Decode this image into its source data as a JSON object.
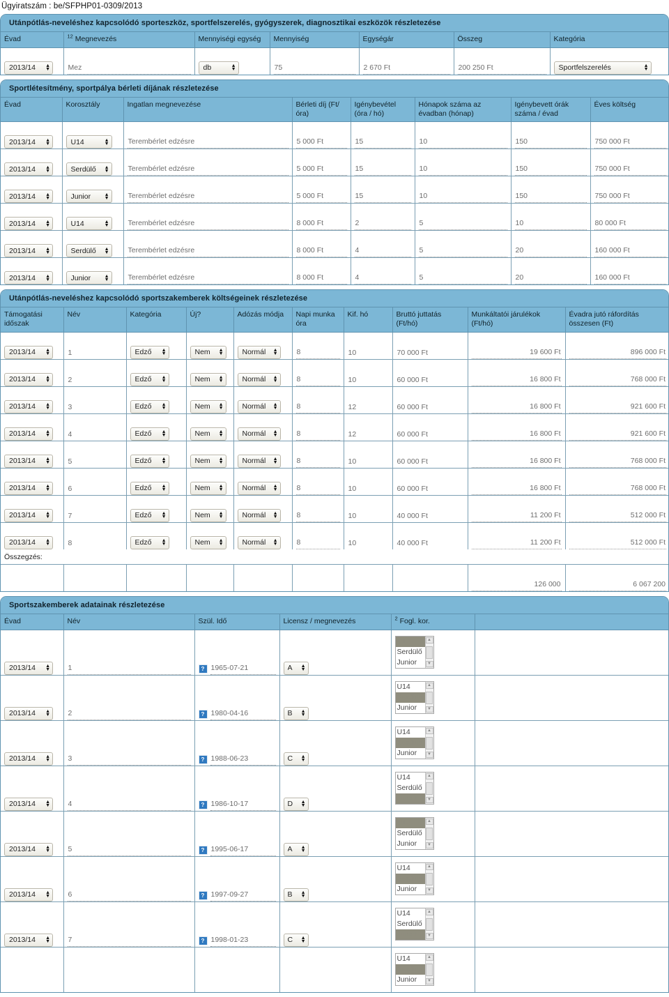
{
  "document": {
    "case_number_label": "Ügyiratszám : be/SFPHP01-0309/2013"
  },
  "section_equipment": {
    "title": "Utánpótlás-neveléshez kapcsolódó sporteszköz, sportfelszerelés, gyógyszerek, diagnosztikai eszközök részletezése",
    "columns": [
      {
        "sup": "",
        "label": "Évad"
      },
      {
        "sup": "12",
        "label": "Megnevezés"
      },
      {
        "sup": "",
        "label": "Mennyiségi egység"
      },
      {
        "sup": "",
        "label": "Mennyiség"
      },
      {
        "sup": "",
        "label": "Egységár"
      },
      {
        "sup": "",
        "label": "Összeg"
      },
      {
        "sup": "",
        "label": "Kategória"
      }
    ],
    "rows": [
      {
        "evad": "2013/14",
        "megnevezes": "Mez",
        "egyseg": "db",
        "mennyiseg": "75",
        "egysegar": "2 670 Ft",
        "osszeg": "200 250 Ft",
        "kategoria": "Sportfelszerelés"
      }
    ]
  },
  "section_rental": {
    "title": "Sportlétesítmény, sportpálya bérleti díjának részletezése",
    "columns": [
      {
        "label": "Évad"
      },
      {
        "label": "Korosztály"
      },
      {
        "label": "Ingatlan megnevezése"
      },
      {
        "label": "Bérleti díj (Ft/óra)"
      },
      {
        "label": "Igénybevétel (óra / hó)"
      },
      {
        "label": "Hónapok száma az évadban (hónap)"
      },
      {
        "label": "Igénybevett órák száma / évad"
      },
      {
        "label": "Éves&nbspköltség"
      }
    ],
    "rows": [
      {
        "evad": "2013/14",
        "korosztaly": "U14",
        "ingatlan": "Terembérlet edzésre",
        "berleti_dij": "5 000 Ft",
        "igenybevetel": "15",
        "honapok": "10",
        "orak": "150",
        "eves_koltseg": "750 000 Ft"
      },
      {
        "evad": "2013/14",
        "korosztaly": "Serdülő",
        "ingatlan": "Terembérlet edzésre",
        "berleti_dij": "5 000 Ft",
        "igenybevetel": "15",
        "honapok": "10",
        "orak": "150",
        "eves_koltseg": "750 000 Ft"
      },
      {
        "evad": "2013/14",
        "korosztaly": "Junior",
        "ingatlan": "Terembérlet edzésre",
        "berleti_dij": "5 000 Ft",
        "igenybevetel": "15",
        "honapok": "10",
        "orak": "150",
        "eves_koltseg": "750 000 Ft"
      },
      {
        "evad": "2013/14",
        "korosztaly": "U14",
        "ingatlan": "Terembérlet edzésre",
        "berleti_dij": "8 000 Ft",
        "igenybevetel": "2",
        "honapok": "5",
        "orak": "10",
        "eves_koltseg": "80 000 Ft"
      },
      {
        "evad": "2013/14",
        "korosztaly": "Serdülő",
        "ingatlan": "Terembérlet edzésre",
        "berleti_dij": "8 000 Ft",
        "igenybevetel": "4",
        "honapok": "5",
        "orak": "20",
        "eves_koltseg": "160 000 Ft"
      },
      {
        "evad": "2013/14",
        "korosztaly": "Junior",
        "ingatlan": "Terembérlet edzésre",
        "berleti_dij": "8 000 Ft",
        "igenybevetel": "4",
        "honapok": "5",
        "orak": "20",
        "eves_koltseg": "160 000 Ft"
      }
    ]
  },
  "section_staff_costs": {
    "title": "Utánpótlás-neveléshez kapcsolódó sportszakemberek költségeinek részletezése",
    "columns": [
      {
        "label": "Támogatási időszak"
      },
      {
        "label": "Név"
      },
      {
        "label": "Kategória"
      },
      {
        "label": "Új?"
      },
      {
        "label": "Adózás módja"
      },
      {
        "label": "Napi munka óra"
      },
      {
        "label": "Kif. hó"
      },
      {
        "label": "Bruttó juttatás (Ft/hó)"
      },
      {
        "label": "Munkáltatói járulékok (Ft/hó)"
      },
      {
        "label": "Évadra jutó ráfordítás összesen (Ft)"
      }
    ],
    "rows": [
      {
        "idoszak": "2013/14",
        "nev": "1",
        "kategoria": "Edző",
        "uj": "Nem",
        "adozas": "Normál",
        "napi_ora": "8",
        "kif_ho": "10",
        "brutto": "70 000 Ft",
        "jarulek": "19 600 Ft",
        "evadra": "896 000 Ft"
      },
      {
        "idoszak": "2013/14",
        "nev": "2",
        "kategoria": "Edző",
        "uj": "Nem",
        "adozas": "Normál",
        "napi_ora": "8",
        "kif_ho": "10",
        "brutto": "60 000 Ft",
        "jarulek": "16 800 Ft",
        "evadra": "768 000 Ft"
      },
      {
        "idoszak": "2013/14",
        "nev": "3",
        "kategoria": "Edző",
        "uj": "Nem",
        "adozas": "Normál",
        "napi_ora": "8",
        "kif_ho": "12",
        "brutto": "60 000 Ft",
        "jarulek": "16 800 Ft",
        "evadra": "921 600 Ft"
      },
      {
        "idoszak": "2013/14",
        "nev": "4",
        "kategoria": "Edző",
        "uj": "Nem",
        "adozas": "Normál",
        "napi_ora": "8",
        "kif_ho": "12",
        "brutto": "60 000 Ft",
        "jarulek": "16 800 Ft",
        "evadra": "921 600 Ft"
      },
      {
        "idoszak": "2013/14",
        "nev": "5",
        "kategoria": "Edző",
        "uj": "Nem",
        "adozas": "Normál",
        "napi_ora": "8",
        "kif_ho": "10",
        "brutto": "60 000 Ft",
        "jarulek": "16 800 Ft",
        "evadra": "768 000 Ft"
      },
      {
        "idoszak": "2013/14",
        "nev": "6",
        "kategoria": "Edző",
        "uj": "Nem",
        "adozas": "Normál",
        "napi_ora": "8",
        "kif_ho": "10",
        "brutto": "60 000 Ft",
        "jarulek": "16 800 Ft",
        "evadra": "768 000 Ft"
      },
      {
        "idoszak": "2013/14",
        "nev": "7",
        "kategoria": "Edző",
        "uj": "Nem",
        "adozas": "Normál",
        "napi_ora": "8",
        "kif_ho": "10",
        "brutto": "40 000 Ft",
        "jarulek": "11 200 Ft",
        "evadra": "512 000 Ft"
      },
      {
        "idoszak": "2013/14",
        "nev": "8",
        "kategoria": "Edző",
        "uj": "Nem",
        "adozas": "Normál",
        "napi_ora": "8",
        "kif_ho": "10",
        "brutto": "40 000 Ft",
        "jarulek": "11 200 Ft",
        "evadra": "512 000 Ft"
      }
    ],
    "summary_label": "Összegzés:",
    "summary": {
      "jarulek_total": "126 000",
      "evadra_total": "6 067 200"
    }
  },
  "section_staff_data": {
    "title": "Sportszakemberek adatainak részletezése",
    "columns": [
      {
        "sup": "",
        "label": "Évad"
      },
      {
        "sup": "",
        "label": "Név"
      },
      {
        "sup": "",
        "label": "Szül. Idő"
      },
      {
        "sup": "",
        "label": "Licensz / megnevezés"
      },
      {
        "sup": "2",
        "label": "Fogl. kor."
      }
    ],
    "age_options": [
      "U14",
      "Serdülő",
      "Junior"
    ],
    "rows": [
      {
        "evad": "2013/14",
        "nev": "1",
        "szul_ido": "1965-07-21",
        "licensz": "A",
        "selected": [
          "U14"
        ]
      },
      {
        "evad": "2013/14",
        "nev": "2",
        "szul_ido": "1980-04-16",
        "licensz": "B",
        "selected": [
          "Serdülő"
        ]
      },
      {
        "evad": "2013/14",
        "nev": "3",
        "szul_ido": "1988-06-23",
        "licensz": "C",
        "selected": [
          "Serdülő"
        ]
      },
      {
        "evad": "2013/14",
        "nev": "4",
        "szul_ido": "1986-10-17",
        "licensz": "D",
        "selected": [
          "Junior"
        ]
      },
      {
        "evad": "2013/14",
        "nev": "5",
        "szul_ido": "1995-06-17",
        "licensz": "A",
        "selected": [
          "U14"
        ]
      },
      {
        "evad": "2013/14",
        "nev": "6",
        "szul_ido": "1997-09-27",
        "licensz": "B",
        "selected": [
          "Serdülő"
        ]
      },
      {
        "evad": "2013/14",
        "nev": "7",
        "szul_ido": "1998-01-23",
        "licensz": "C",
        "selected": [
          "Junior"
        ]
      },
      {
        "evad": "",
        "nev": "",
        "szul_ido": "",
        "licensz": "",
        "selected": [
          "Serdülő"
        ]
      }
    ],
    "calendar_icon_glyph": "?"
  },
  "colors": {
    "header_blue": "#7cb7d6",
    "border_blue": "#5f93b0",
    "grid_line": "#7b9fb3",
    "select_highlight": "#8f8d7e"
  }
}
